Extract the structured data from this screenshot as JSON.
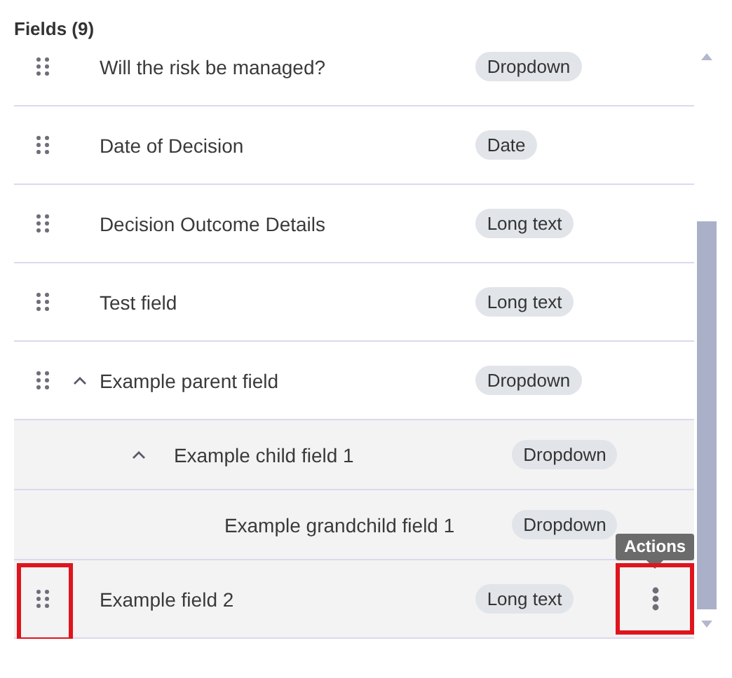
{
  "heading": "Fields (9)",
  "fields": [
    {
      "label": "Will the risk be managed?",
      "type": "Dropdown",
      "hovered": false,
      "annotated": false
    },
    {
      "label": "Date of Decision",
      "type": "Date",
      "hovered": false,
      "annotated": false
    },
    {
      "label": "Decision Outcome Details",
      "type": "Long text",
      "hovered": false,
      "annotated": false
    },
    {
      "label": "Test field",
      "type": "Long text",
      "hovered": false,
      "annotated": false
    },
    {
      "label": "Example parent field",
      "type": "Dropdown",
      "hovered": false,
      "annotated": false,
      "expanded": true,
      "children": [
        {
          "label": "Example child field 1",
          "type": "Dropdown",
          "hovered": false,
          "annotated": false,
          "expanded": true,
          "children": [
            {
              "label": "Example grandchild field 1",
              "type": "Dropdown",
              "hovered": false,
              "annotated": false
            }
          ]
        }
      ]
    },
    {
      "label": "Example field 2",
      "type": "Long text",
      "hovered": true,
      "annotated": true,
      "tooltip": "Actions"
    }
  ]
}
